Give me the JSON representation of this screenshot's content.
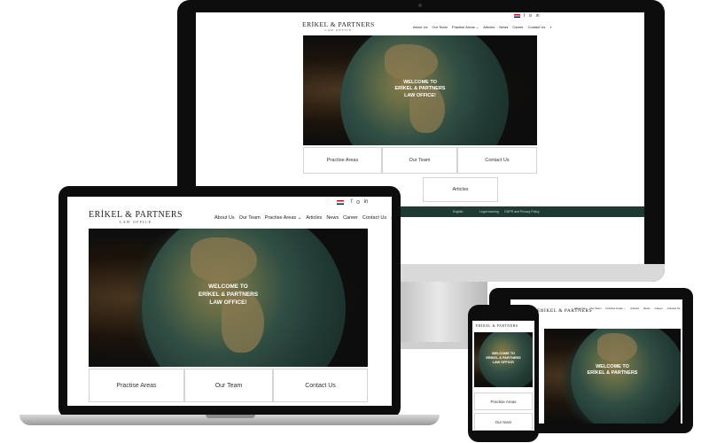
{
  "site": {
    "logo_name": "ERİKEL & PARTNERS",
    "logo_sub": "LAW OFFICE",
    "nav": [
      "About Us",
      "Our Team",
      "Practise Areas ⌄",
      "Articles",
      "News",
      "Career",
      "Contact Us"
    ],
    "search_glyph": "⌕",
    "social": [
      "f",
      "⊙",
      "in"
    ],
    "hero_line1": "WELCOME TO",
    "hero_line2": "ERİKEL & PARTNERS",
    "hero_line3": "LAW OFFICE!",
    "boxes": [
      "Practise Areas",
      "Our Team",
      "Contact Us",
      "Articles"
    ],
    "footer": {
      "language": "English",
      "legal_warning": "Legal warning",
      "privacy": "GDPR and Privacy Policy"
    },
    "phone_box2": "Our team"
  },
  "colors": {
    "footer_bg": "#1f3a33",
    "device_frame": "#0d0d0d"
  },
  "icons": {
    "flag": "uk-flag-icon",
    "facebook": "facebook-icon",
    "instagram": "instagram-icon",
    "linkedin": "linkedin-icon",
    "search": "search-icon"
  }
}
